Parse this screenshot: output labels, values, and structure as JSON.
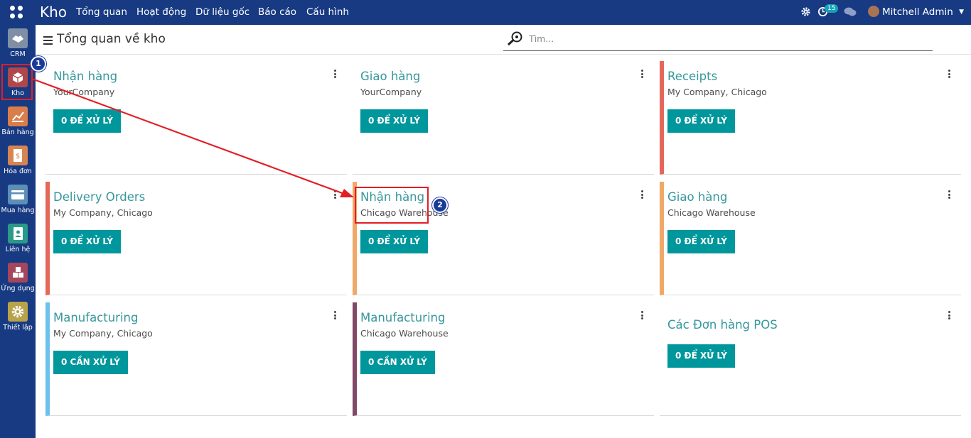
{
  "topbar": {
    "app_name": "Kho",
    "menu": [
      "Tổng quan",
      "Hoạt động",
      "Dữ liệu gốc",
      "Báo cáo",
      "Cấu hình"
    ],
    "activity_badge": "15",
    "user_name": "Mitchell Admin"
  },
  "sidebar": {
    "items": [
      {
        "label": "CRM",
        "icon": "handshake-icon",
        "color": "#7f8fa6"
      },
      {
        "label": "Kho",
        "icon": "box-icon",
        "color": "#b0474c"
      },
      {
        "label": "Bán hàng",
        "icon": "chart-icon",
        "color": "#d97e4a"
      },
      {
        "label": "Hóa đơn",
        "icon": "invoice-icon",
        "color": "#d68452"
      },
      {
        "label": "Mua hàng",
        "icon": "credit-card-icon",
        "color": "#5c8fb8"
      },
      {
        "label": "Liên hệ",
        "icon": "contact-book-icon",
        "color": "#2a9a8a"
      },
      {
        "label": "Ứng dụng",
        "icon": "cubes-icon",
        "color": "#a4465c"
      },
      {
        "label": "Thiết lập",
        "icon": "gear-icon",
        "color": "#b8a34b"
      }
    ]
  },
  "control_panel": {
    "title": "Tổng quan về kho",
    "search_placeholder": "Tìm..."
  },
  "cards": [
    {
      "title": "Nhận hàng",
      "subtitle": "YourCompany",
      "button": "0 ĐỂ XỬ LÝ",
      "color": ""
    },
    {
      "title": "Giao hàng",
      "subtitle": "YourCompany",
      "button": "0 ĐỂ XỬ LÝ",
      "color": ""
    },
    {
      "title": "Receipts",
      "subtitle": "My Company, Chicago",
      "button": "0 ĐỂ XỬ LÝ",
      "color": "#e5675a"
    },
    {
      "title": "Delivery Orders",
      "subtitle": "My Company, Chicago",
      "button": "0 ĐỂ XỬ LÝ",
      "color": "#e5675a"
    },
    {
      "title": "Nhận hàng",
      "subtitle": "Chicago Warehouse",
      "button": "0 ĐỂ XỬ LÝ",
      "color": "#f0a868"
    },
    {
      "title": "Giao hàng",
      "subtitle": "Chicago Warehouse",
      "button": "0 ĐỂ XỬ LÝ",
      "color": "#f0a868"
    },
    {
      "title": "Manufacturing",
      "subtitle": "My Company, Chicago",
      "button": "0 CẦN XỬ LÝ",
      "color": "#6cc1ed"
    },
    {
      "title": "Manufacturing",
      "subtitle": "Chicago Warehouse",
      "button": "0 CẦN XỬ LÝ",
      "color": "#814968"
    },
    {
      "title": "Các Đơn hàng POS",
      "subtitle": "",
      "button": "0 ĐỂ XỬ LÝ",
      "color": ""
    }
  ],
  "annotations": {
    "marker1": "1",
    "marker2": "2"
  }
}
